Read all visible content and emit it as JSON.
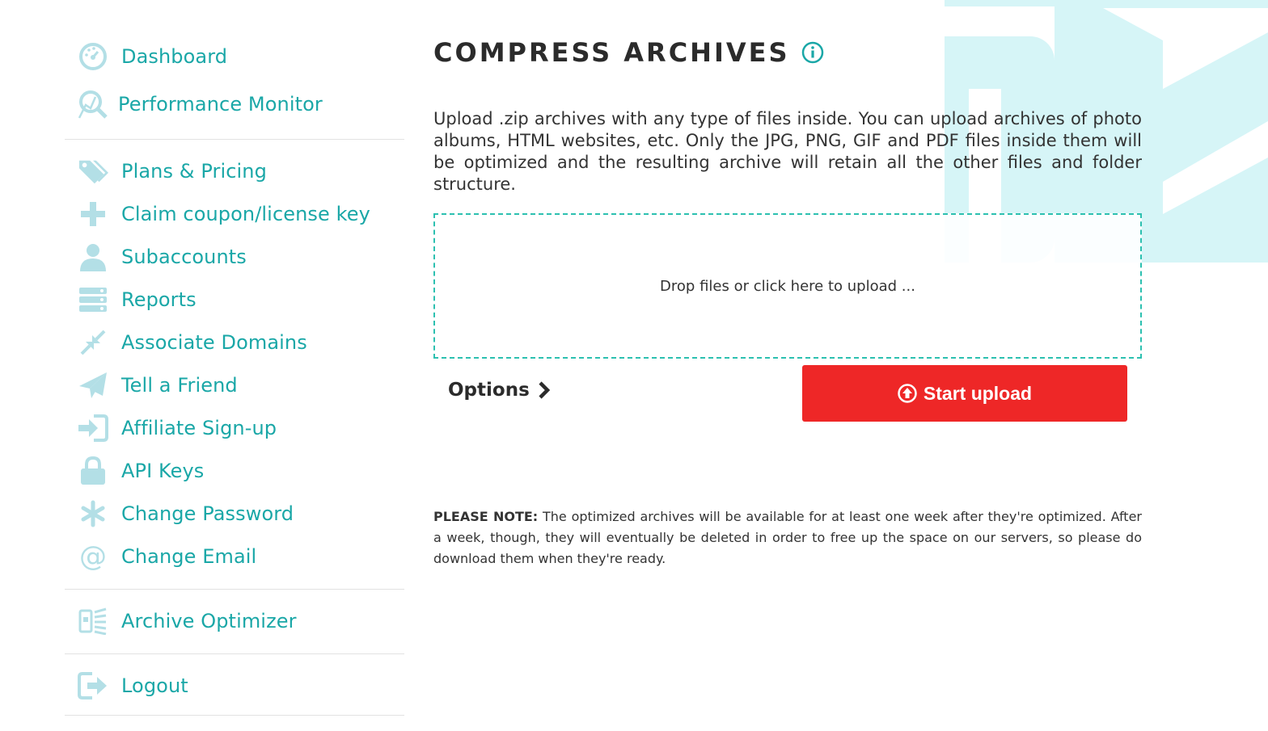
{
  "sidebar": {
    "group_a": [
      {
        "label": "Dashboard",
        "icon": "dashboard-icon"
      },
      {
        "label": "Performance Monitor",
        "icon": "performance-monitor-icon"
      }
    ],
    "group_b": [
      {
        "label": "Plans & Pricing",
        "icon": "price-tag-icon"
      },
      {
        "label": "Claim coupon/license key",
        "icon": "plus-icon"
      },
      {
        "label": "Subaccounts",
        "icon": "user-icon"
      },
      {
        "label": "Reports",
        "icon": "reports-icon"
      },
      {
        "label": "Associate Domains",
        "icon": "compress-arrows-icon"
      },
      {
        "label": "Tell a Friend",
        "icon": "paper-plane-icon"
      },
      {
        "label": "Affiliate Sign-up",
        "icon": "sign-in-icon"
      },
      {
        "label": "API Keys",
        "icon": "lock-icon"
      },
      {
        "label": "Change Password",
        "icon": "asterisk-icon"
      },
      {
        "label": "Change Email",
        "icon": "at-sign-icon"
      }
    ],
    "group_c": [
      {
        "label": "Archive Optimizer",
        "icon": "archive-icon"
      }
    ],
    "group_d": [
      {
        "label": "Logout",
        "icon": "logout-icon"
      }
    ]
  },
  "main": {
    "title": "COMPRESS ARCHIVES",
    "description": "Upload .zip archives with any type of files inside. You can upload archives of photo albums, HTML websites, etc. Only the JPG, PNG, GIF and PDF files inside them will be optimized and the resulting archive will retain all the other files and folder structure.",
    "dropzone_text": "Drop files or click here to upload ...",
    "options_label": "Options",
    "start_upload_label": "Start upload",
    "note_label": "PLEASE NOTE:",
    "note_text": " The optimized archives will be available for at least one week after they're optimized. After a week, though, they will eventually be deleted in order to free up the space on our servers, so please do download them when they're ready."
  },
  "colors": {
    "accent": "#1aa7a7",
    "icon": "#b3dfe6",
    "dropzone_border": "#2cc0b0",
    "primary_button": "#ee2727",
    "decoration": "#d6f5f7"
  }
}
